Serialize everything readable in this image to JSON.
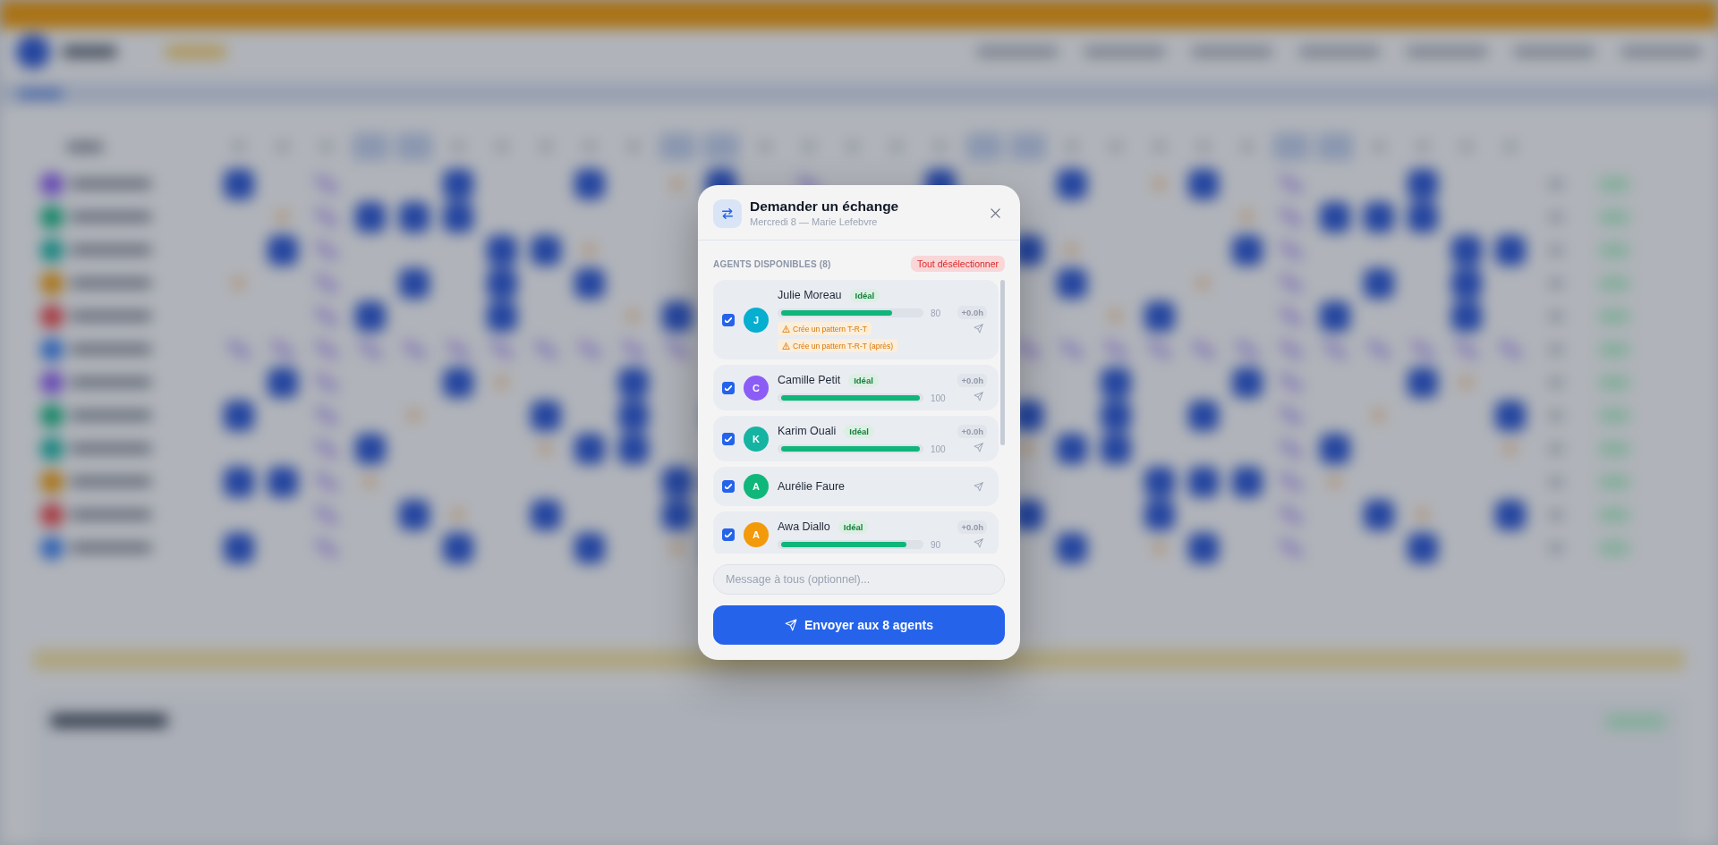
{
  "dialog": {
    "title": "Demander un échange",
    "subtitle": "Mercredi 8 — Marie Lefebvre",
    "section_label": "AGENTS DISPONIBLES (8)",
    "deselect_all": "Tout désélectionner",
    "agents": [
      {
        "initial": "J",
        "name": "Julie Moreau",
        "color": "#06aed0",
        "checked": true,
        "badge": "Idéal",
        "level": 0.8,
        "score": "80",
        "hours": "+0.0h",
        "warnings": [
          "Crée un pattern T-R-T",
          "Crée un pattern T-R-T (après)"
        ]
      },
      {
        "initial": "C",
        "name": "Camille Petit",
        "color": "#8b5cf6",
        "checked": true,
        "badge": "Idéal",
        "level": 1,
        "score": "100",
        "hours": "+0.0h"
      },
      {
        "initial": "K",
        "name": "Karim Ouali",
        "color": "#14b3a2",
        "checked": true,
        "badge": "Idéal",
        "level": 1,
        "score": "100",
        "hours": "+0.0h"
      },
      {
        "initial": "A",
        "name": "Aurélie Faure",
        "color": "#10b77a",
        "checked": true
      },
      {
        "initial": "A",
        "name": "Awa Diallo",
        "color": "#f29a0a",
        "checked": true,
        "badge": "Idéal",
        "level": 0.9,
        "score": "90",
        "hours": "+0.0h"
      }
    ],
    "message": {
      "placeholder": "Message à tous (optionnel)..."
    },
    "send_label": "Envoyer aux 8 agents"
  }
}
